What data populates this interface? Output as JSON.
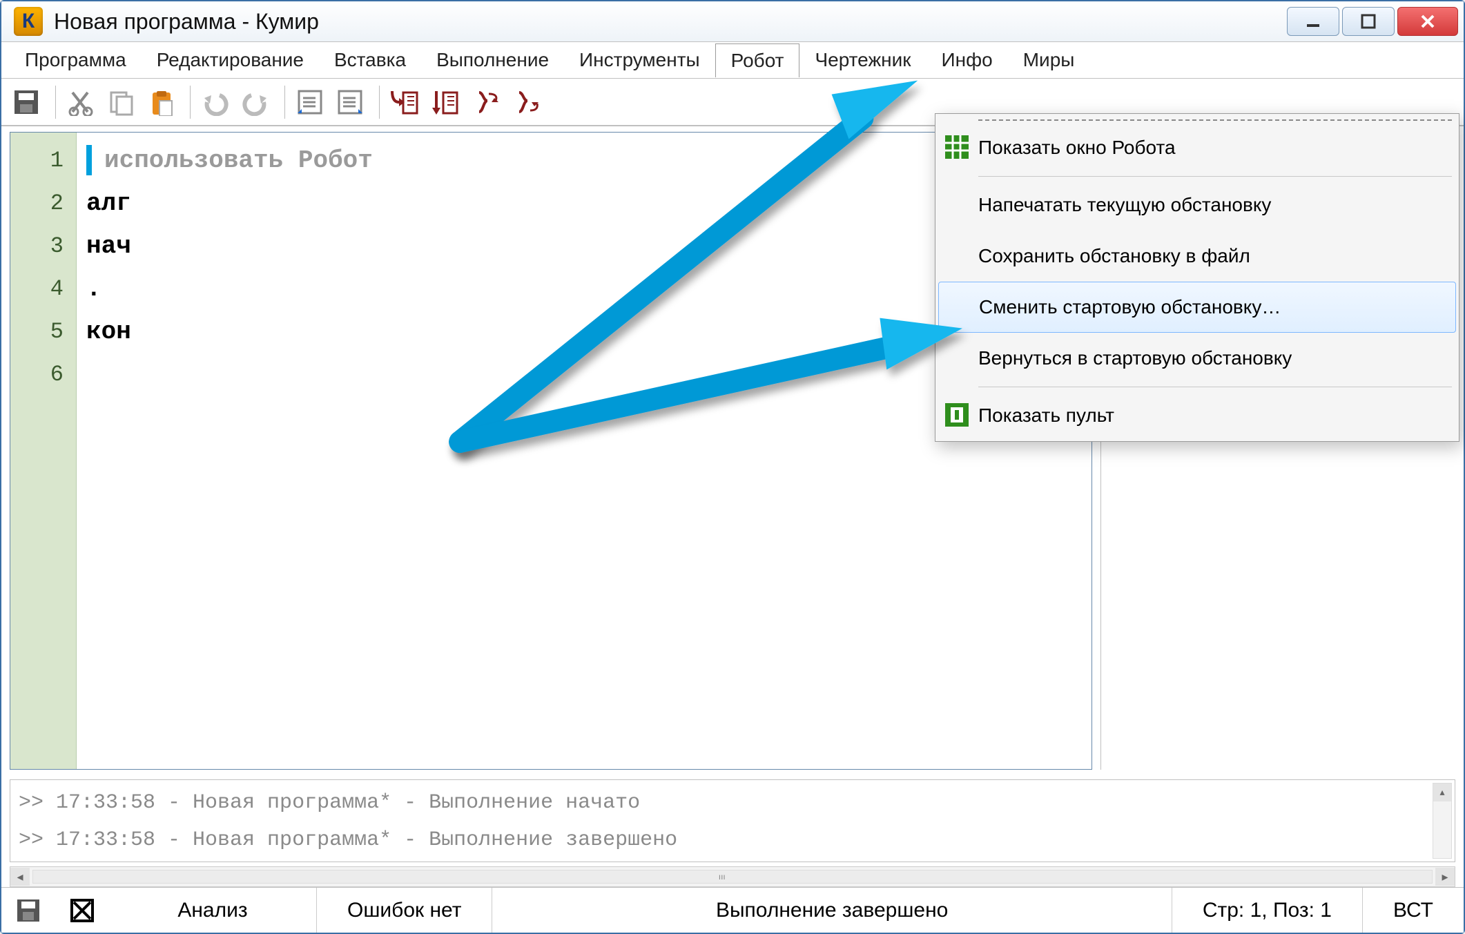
{
  "titlebar": {
    "title": "Новая программа - Кумир"
  },
  "menubar": {
    "items": [
      "Программа",
      "Редактирование",
      "Вставка",
      "Выполнение",
      "Инструменты",
      "Робот",
      "Чертежник",
      "Инфо",
      "Миры"
    ],
    "active_index": 5
  },
  "toolbar": {
    "icons": [
      "save",
      "cut",
      "copy",
      "paste",
      "undo",
      "redo",
      "indent-left",
      "indent-right",
      "step-into",
      "step-run",
      "brace-open",
      "brace-close"
    ]
  },
  "editor": {
    "lines": [
      {
        "n": "1",
        "type": "uses",
        "text": "использовать Робот"
      },
      {
        "n": "2",
        "type": "kw",
        "text": "алг"
      },
      {
        "n": "3",
        "type": "kw",
        "text": "нач"
      },
      {
        "n": "4",
        "type": "kw",
        "text": "."
      },
      {
        "n": "5",
        "type": "kw",
        "text": "кон"
      },
      {
        "n": "6",
        "type": "",
        "text": ""
      }
    ]
  },
  "dropdown": {
    "items": [
      {
        "label": "Показать окно Робота",
        "icon": "grid"
      },
      {
        "label": "Напечатать текущую обстановку",
        "icon": ""
      },
      {
        "label": "Сохранить обстановку в файл",
        "icon": ""
      },
      {
        "label": "Сменить стартовую обстановку…",
        "icon": "",
        "hover": true
      },
      {
        "label": "Вернуться в стартовую обстановку",
        "icon": ""
      },
      {
        "label": "Показать пульт",
        "icon": "gauge"
      }
    ]
  },
  "console": {
    "lines": [
      ">> 17:33:58 - Новая программа* - Выполнение начато",
      ">> 17:33:58 - Новая программа* - Выполнение завершено"
    ]
  },
  "statusbar": {
    "analysis": "Анализ",
    "errors": "Ошибок нет",
    "exec": "Выполнение завершено",
    "pos": "Стр: 1, Поз: 1",
    "ins": "ВСТ"
  }
}
